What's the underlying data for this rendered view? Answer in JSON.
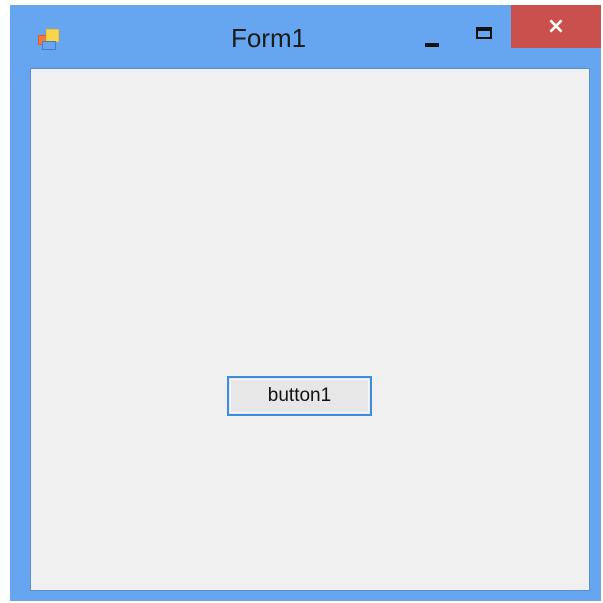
{
  "window": {
    "title": "Form1",
    "caption_buttons": {
      "minimize": "minimize",
      "maximize": "maximize",
      "close": "×"
    },
    "colors": {
      "frame": "#66a6f0",
      "close": "#c9504c",
      "client": "#f0f0f0",
      "button_border": "#3c8ce0"
    }
  },
  "form": {
    "button1_label": "button1"
  },
  "icons": {
    "app": "windows-form-icon",
    "minimize": "minimize-icon",
    "maximize": "maximize-icon",
    "close": "close-icon"
  }
}
